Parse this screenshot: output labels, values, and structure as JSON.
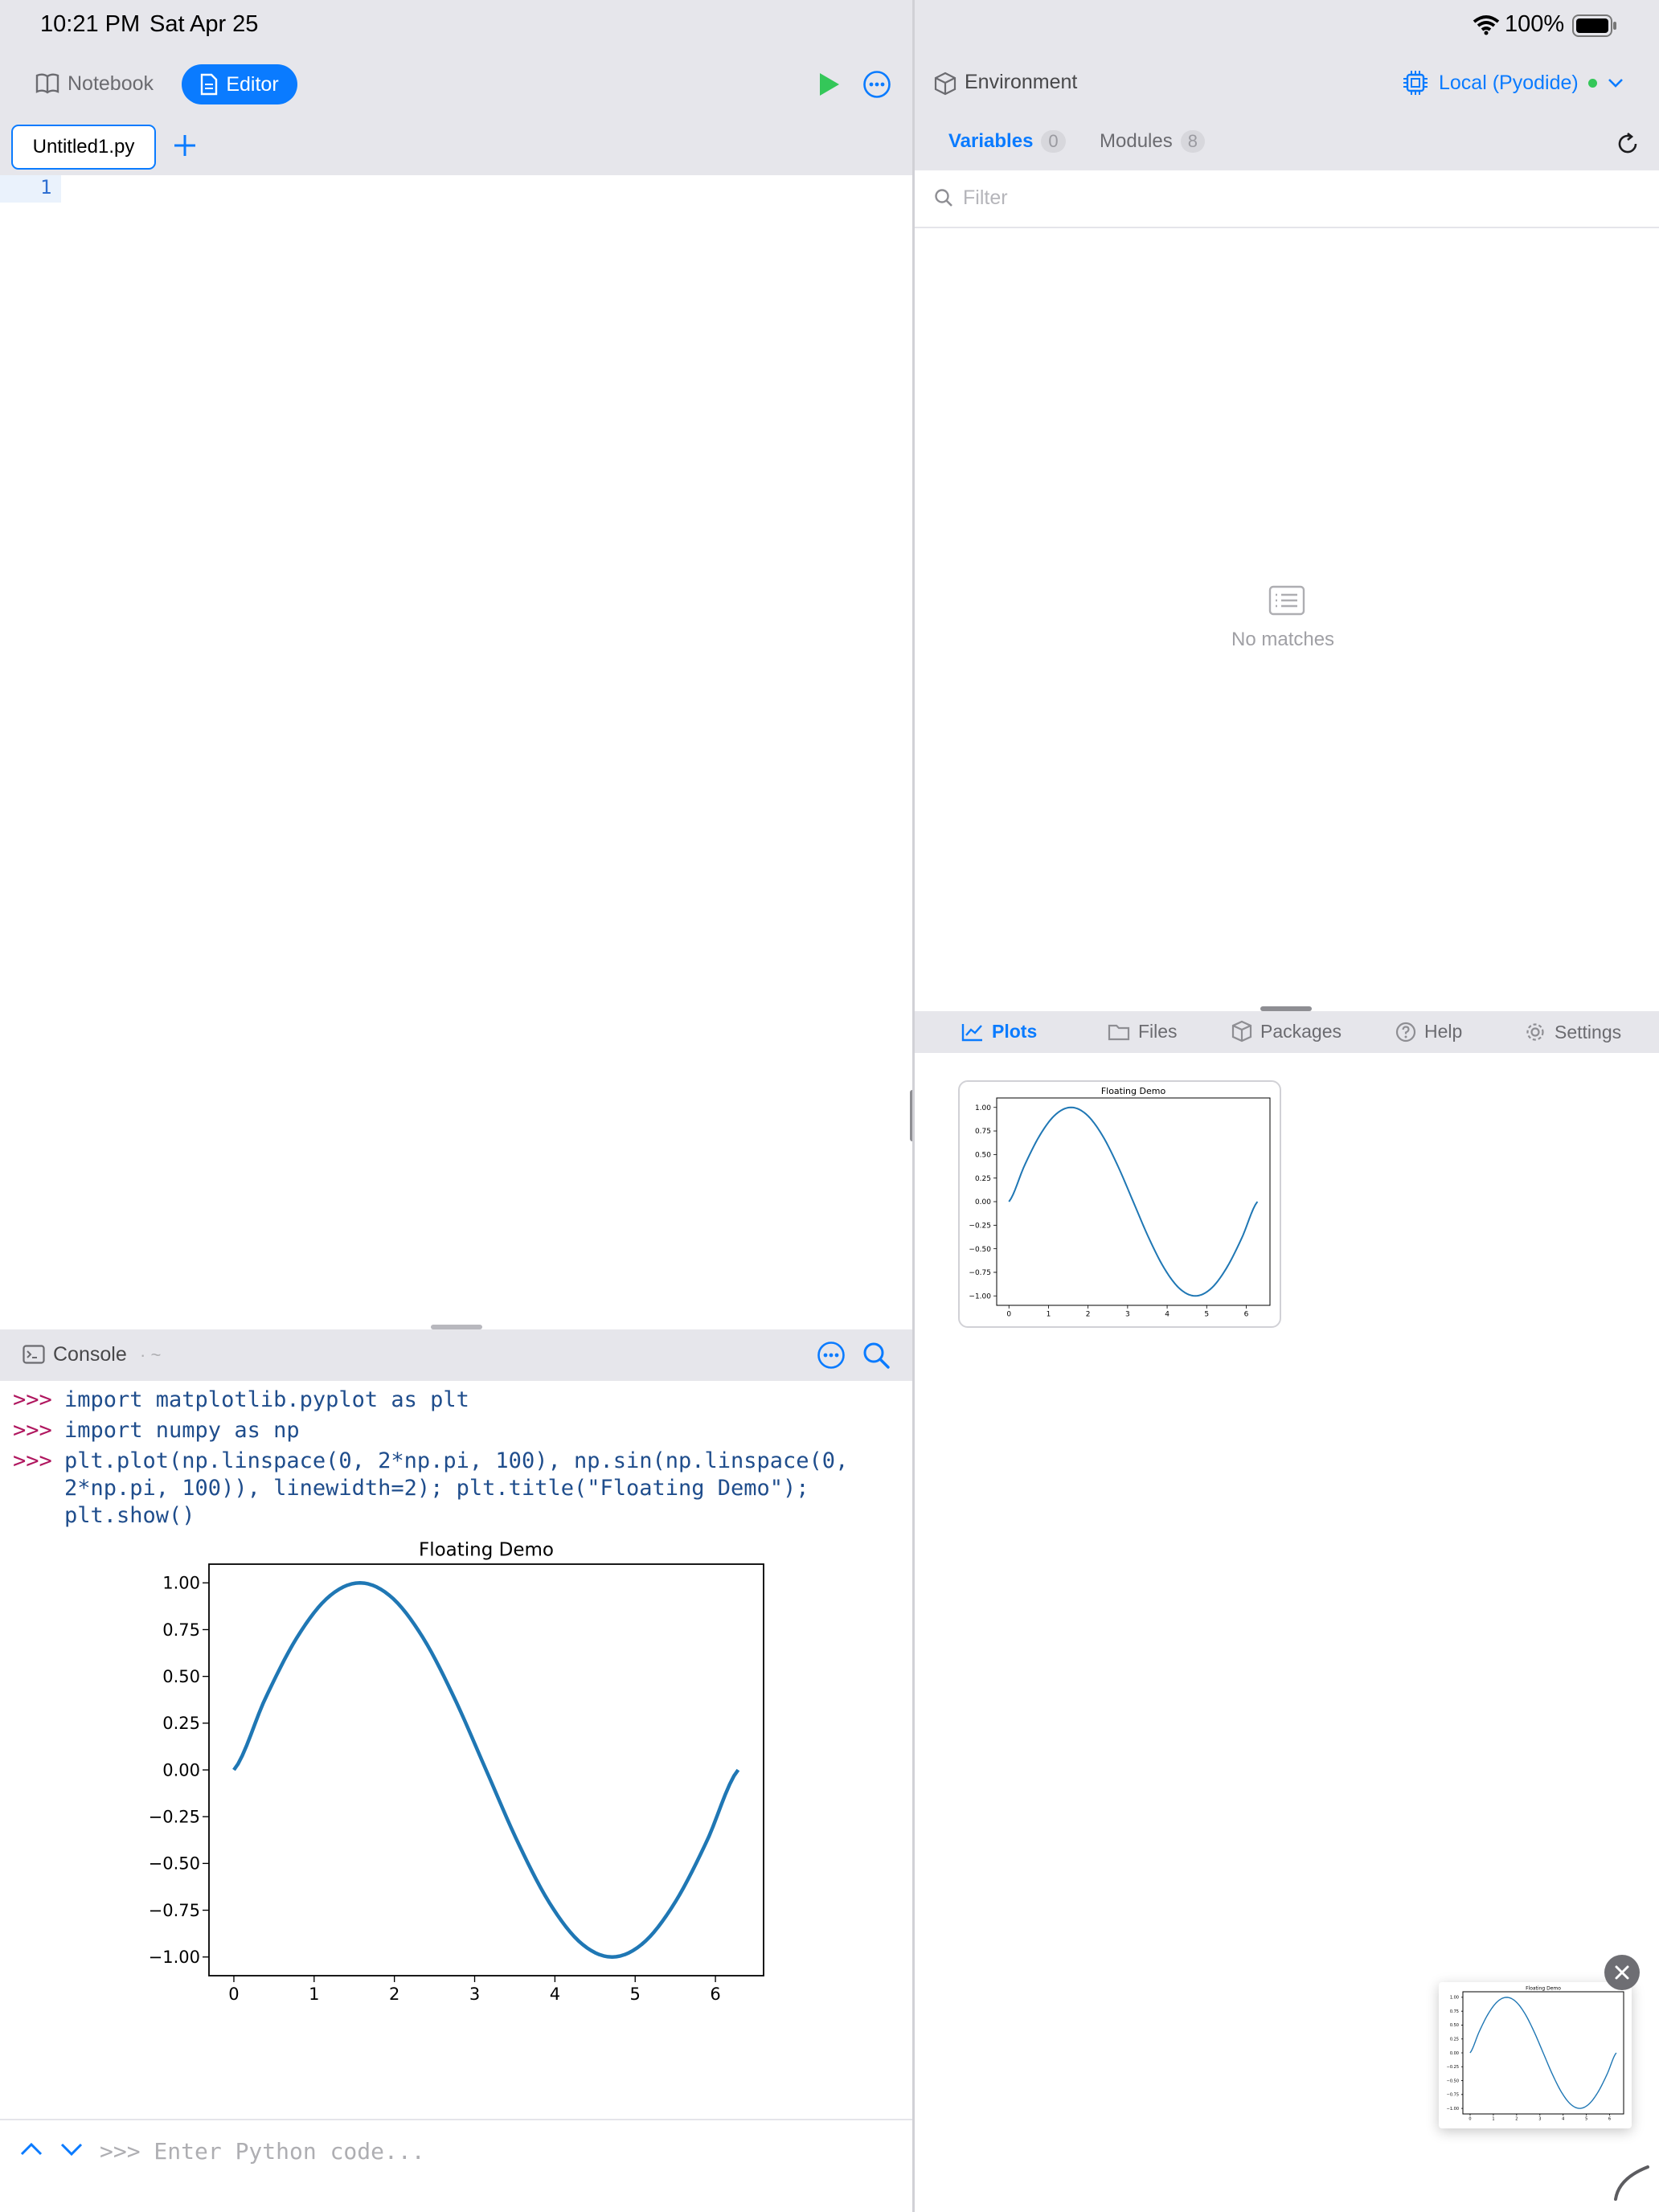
{
  "status": {
    "time": "10:21 PM",
    "date": "Sat Apr 25",
    "battery": "100%"
  },
  "toolbar": {
    "notebook_label": "Notebook",
    "editor_label": "Editor"
  },
  "editor": {
    "tab_label": "Untitled1.py",
    "line_number": "1"
  },
  "console": {
    "title": "Console",
    "path": "· ~",
    "prompt": ">>>",
    "lines": [
      "import matplotlib.pyplot as plt",
      "import numpy as np",
      "plt.plot(np.linspace(0, 2*np.pi, 100), np.sin(np.linspace(0,",
      "2*np.pi, 100)), linewidth=2); plt.title(\"Floating Demo\");",
      "plt.show()"
    ],
    "input_placeholder": ">>> Enter Python code..."
  },
  "environment": {
    "title": "Environment",
    "runtime": "Local (Pyodide)",
    "tabs": [
      {
        "label": "Variables",
        "count": "0"
      },
      {
        "label": "Modules",
        "count": "8"
      }
    ],
    "filter_placeholder": "Filter",
    "empty_text": "No matches"
  },
  "bottom_tabs": [
    "Plots",
    "Files",
    "Packages",
    "Help",
    "Settings"
  ],
  "colors": {
    "accent": "#0a7bff",
    "run": "#34c759",
    "line": "#1f77b4",
    "prompt": "#b0175f",
    "code": "#1f4d8c"
  },
  "chart_data": {
    "type": "line",
    "title": "Floating Demo",
    "xlabel": "",
    "ylabel": "",
    "xlim": [
      -0.31,
      6.6
    ],
    "ylim": [
      -1.1,
      1.1
    ],
    "xticks": [
      "0",
      "1",
      "2",
      "3",
      "4",
      "5",
      "6"
    ],
    "xtick_values": [
      0,
      1,
      2,
      3,
      4,
      5,
      6
    ],
    "yticks": [
      "1.00",
      "0.75",
      "0.50",
      "0.25",
      "0.00",
      "−0.25",
      "−0.50",
      "−0.75",
      "−1.00"
    ],
    "ytick_values": [
      1,
      0.75,
      0.5,
      0.25,
      0,
      -0.25,
      -0.5,
      -0.75,
      -1
    ],
    "series": [
      {
        "x": [
          0,
          0.393,
          0.785,
          1.178,
          1.571,
          1.963,
          2.356,
          2.749,
          3.142,
          3.534,
          3.927,
          4.32,
          4.712,
          5.105,
          5.498,
          5.89,
          6.283
        ],
        "values": [
          0,
          0.383,
          0.707,
          0.924,
          1.0,
          0.924,
          0.707,
          0.383,
          0,
          -0.383,
          -0.707,
          -0.924,
          -1.0,
          -0.924,
          -0.707,
          -0.383,
          0
        ],
        "color": "#1f77b4"
      }
    ]
  }
}
